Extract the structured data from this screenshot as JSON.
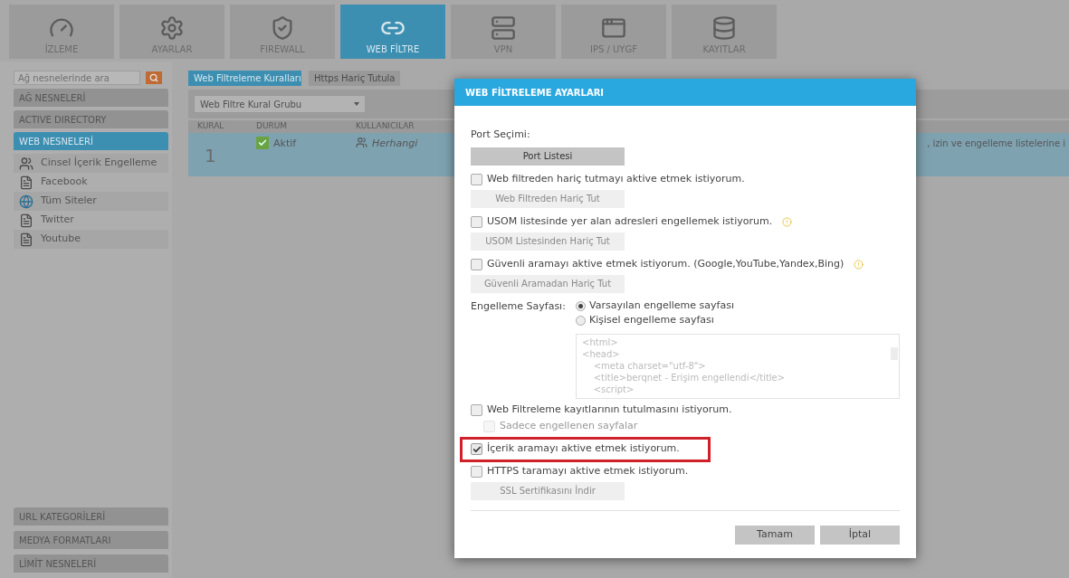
{
  "nav_tabs": [
    {
      "label": "İZLEME",
      "selected": false
    },
    {
      "label": "AYARLAR",
      "selected": false
    },
    {
      "label": "FIREWALL",
      "selected": false
    },
    {
      "label": "WEB FİLTRE",
      "selected": true
    },
    {
      "label": "VPN",
      "selected": false
    },
    {
      "label": "IPS / UYGF",
      "selected": false
    },
    {
      "label": "KAYITLAR",
      "selected": false
    }
  ],
  "sidebar": {
    "search_placeholder": "Ağ nesnelerinde ara",
    "sections_top": [
      {
        "label": "AĞ NESNELERİ",
        "selected": false
      },
      {
        "label": "ACTIVE DIRECTORY",
        "selected": false
      },
      {
        "label": "WEB NESNELERİ",
        "selected": true
      }
    ],
    "items": [
      {
        "label": "Cinsel İçerik Engelleme",
        "kind": "group"
      },
      {
        "label": "Facebook",
        "kind": "site"
      },
      {
        "label": "Tüm Siteler",
        "kind": "globe"
      },
      {
        "label": "Twitter",
        "kind": "site"
      },
      {
        "label": "Youtube",
        "kind": "site"
      }
    ],
    "sections_bottom": [
      {
        "label": "URL KATEGORİLERİ"
      },
      {
        "label": "MEDYA FORMATLARI"
      },
      {
        "label": "LİMİT NESNELERİ"
      }
    ]
  },
  "main": {
    "tabs": [
      {
        "label": "Web Filtreleme Kuralları",
        "selected": true
      },
      {
        "label": "Https Hariç Tutula",
        "selected": false
      }
    ],
    "group_select": "Web Filtre Kural Grubu",
    "columns": [
      "KURAL",
      "DURUM",
      "KULLANICILAR"
    ],
    "rows": [
      {
        "kural": "1",
        "durum": "Aktif",
        "active": true,
        "users": "Herhangi",
        "column_4": ", izin ve engelleme listelerine i"
      }
    ]
  },
  "dialog": {
    "title": "WEB FİLTRELEME AYARLARI",
    "items": [
      {
        "kind": "label",
        "text": "Port Seçimi:"
      },
      {
        "kind": "button",
        "text": "Port Listesi",
        "disabled": false
      },
      {
        "kind": "checkbox",
        "text": "Web filtreden hariç tutmayı aktive etmek istiyorum.",
        "checked": false,
        "info": false,
        "highlighted": false
      },
      {
        "kind": "button",
        "text": "Web Filtreden Hariç Tut",
        "disabled": true
      },
      {
        "kind": "checkbox",
        "text": "USOM listesinde yer alan adresleri engellemek istiyorum.",
        "checked": false,
        "info": true,
        "highlighted": false
      },
      {
        "kind": "button",
        "text": "USOM Listesinden Hariç Tut",
        "disabled": true
      },
      {
        "kind": "checkbox",
        "text": "Güvenli aramayı aktive etmek istiyorum. (Google,YouTube,Yandex,Bing)",
        "checked": false,
        "info": true,
        "highlighted": false
      },
      {
        "kind": "button",
        "text": "Güvenli Aramadan Hariç Tut",
        "disabled": true
      },
      {
        "kind": "radio_group",
        "text": "Engelleme Sayfası:",
        "options": [
          {
            "label": "Varsayılan engelleme sayfası",
            "selected": true
          },
          {
            "label": "Kişisel engelleme sayfası",
            "selected": false
          }
        ],
        "code_lines": [
          "<html>",
          "<head>",
          "    <meta charset=\"utf-8\">",
          "    <title>berqnet - Erişim engellendi</title>",
          "    <script>"
        ]
      },
      {
        "kind": "checkbox",
        "text": "Web Filtreleme kayıtlarının tutulmasını istiyorum.",
        "checked": false,
        "info": false,
        "highlighted": false
      },
      {
        "kind": "sub_checkbox",
        "text": "Sadece engellenen sayfalar",
        "checked": false
      },
      {
        "kind": "checkbox",
        "text": "İçerik aramayı aktive etmek istiyorum.",
        "checked": true,
        "info": false,
        "highlighted": true
      },
      {
        "kind": "checkbox",
        "text": "HTTPS taramayı aktive etmek istiyorum.",
        "checked": false,
        "info": false,
        "highlighted": false
      },
      {
        "kind": "button",
        "text": "SSL Sertifikasını İndir",
        "disabled": true
      }
    ],
    "buttons": [
      "Tamam",
      "İptal"
    ]
  }
}
